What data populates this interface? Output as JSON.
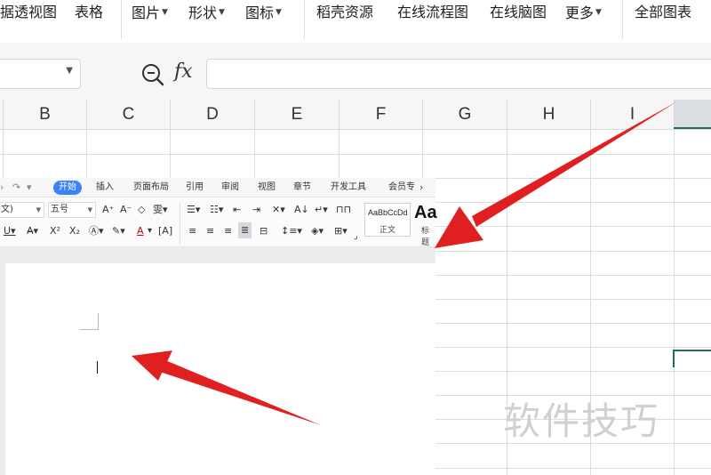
{
  "ribbon": {
    "items": [
      {
        "label": "据透视图"
      },
      {
        "label": "表格"
      },
      {
        "label": "图片"
      },
      {
        "label": "形状"
      },
      {
        "label": "图标"
      },
      {
        "label": "稻壳资源"
      },
      {
        "label": "在线流程图"
      },
      {
        "label": "在线脑图"
      },
      {
        "label": "更多"
      },
      {
        "label": "全部图表"
      }
    ]
  },
  "formula_bar": {
    "fx_label": "fx",
    "formula_value": ""
  },
  "sheet": {
    "columns": [
      "B",
      "C",
      "D",
      "E",
      "F",
      "G",
      "H",
      "I"
    ],
    "selection_color": "#1e7145"
  },
  "writer": {
    "tabs": [
      "开始",
      "插入",
      "页面布局",
      "引用",
      "审阅",
      "视图",
      "章节",
      "开发工具",
      "会员专"
    ],
    "font_name": "文)",
    "font_size": "五号",
    "styles": {
      "normal_sample": "AaBbCcDd",
      "normal_label": "正文",
      "heading_sample": "Aa",
      "heading_label": "标题"
    }
  },
  "annotations": {
    "arrow_color": "#e02020",
    "watermark": "软件技巧"
  }
}
